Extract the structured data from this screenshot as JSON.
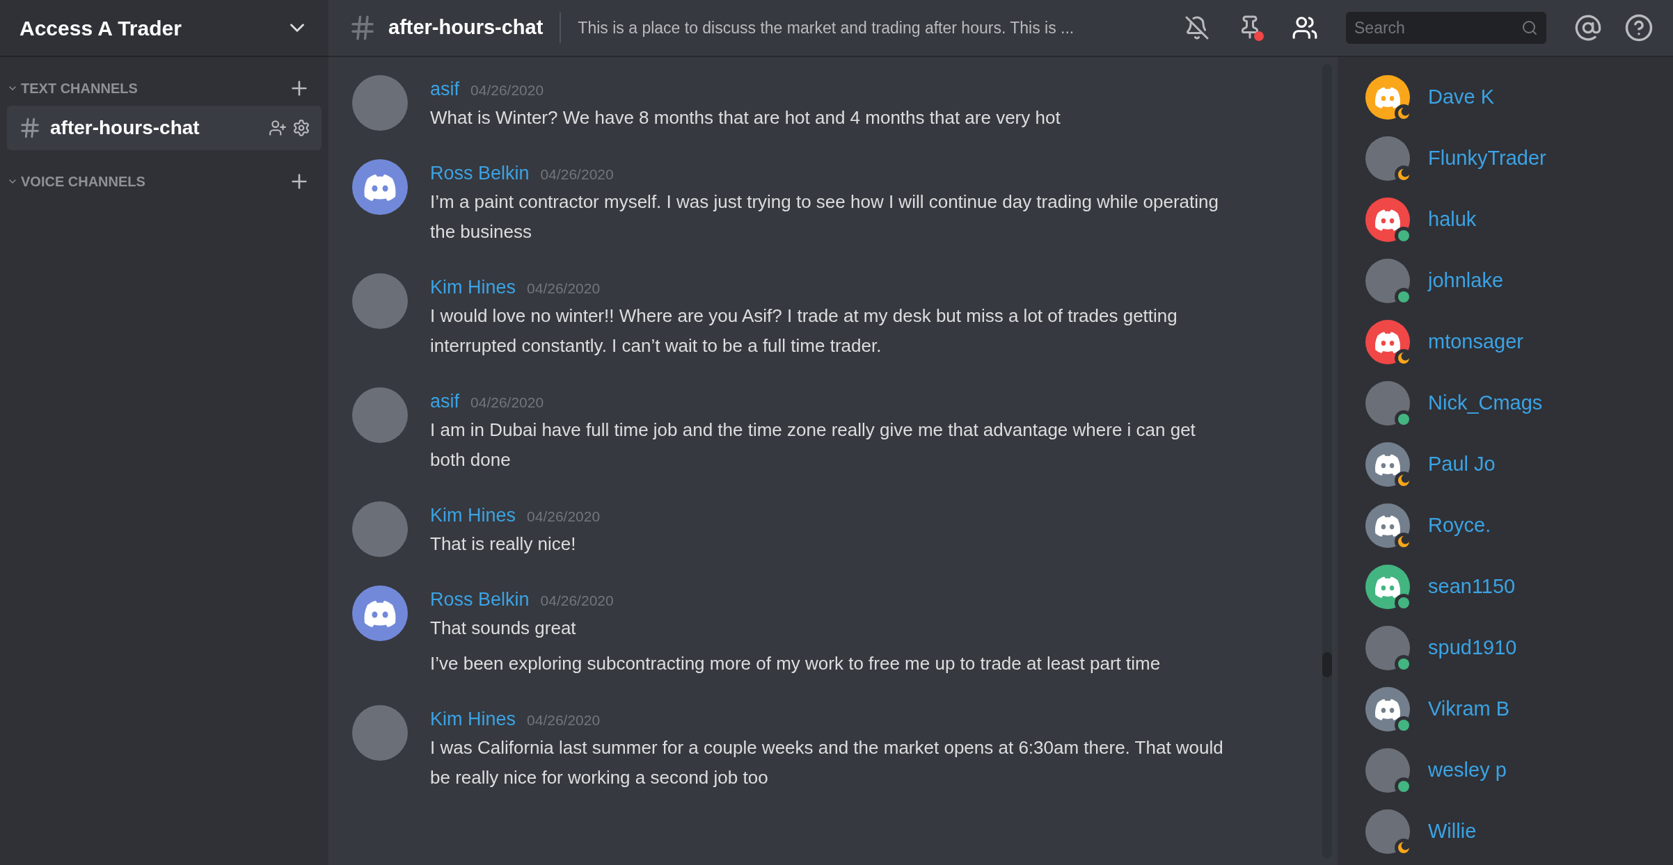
{
  "server": {
    "name": "Access A Trader"
  },
  "sidebar": {
    "categories": [
      {
        "label": "TEXT CHANNELS",
        "expanded": true,
        "channels": [
          {
            "name": "after-hours-chat",
            "selected": true
          }
        ]
      },
      {
        "label": "VOICE CHANNELS",
        "expanded": true
      }
    ]
  },
  "channel": {
    "name": "after-hours-chat",
    "topic": "This is a place to discuss the market and trading after hours. This is ..."
  },
  "search": {
    "placeholder": "Search"
  },
  "messages": [
    {
      "author": "asif",
      "date": "04/26/2020",
      "avatar": {
        "kind": "photo"
      },
      "texts": [
        "What is Winter? We have 8 months that are hot and 4 months that are very hot"
      ]
    },
    {
      "author": "Ross Belkin",
      "date": "04/26/2020",
      "avatar": {
        "kind": "logo",
        "color": "#7289da"
      },
      "texts": [
        "I’m a paint contractor myself. I was just trying to see how I will continue day trading while operating the business"
      ]
    },
    {
      "author": "Kim Hines",
      "date": "04/26/2020",
      "avatar": {
        "kind": "photo"
      },
      "texts": [
        "I would love no winter!! Where are you Asif? I trade at my desk but miss a lot of trades getting interrupted constantly. I can’t wait to be a full time trader."
      ]
    },
    {
      "author": "asif",
      "date": "04/26/2020",
      "avatar": {
        "kind": "photo"
      },
      "texts": [
        "I am in Dubai have full time job and the time zone really give me that advantage where i can get both done"
      ]
    },
    {
      "author": "Kim Hines",
      "date": "04/26/2020",
      "avatar": {
        "kind": "photo"
      },
      "texts": [
        "That is really nice!"
      ]
    },
    {
      "author": "Ross Belkin",
      "date": "04/26/2020",
      "avatar": {
        "kind": "logo",
        "color": "#7289da"
      },
      "texts": [
        "That sounds great",
        "I’ve been exploring subcontracting more of my work to free me up to trade at least part time"
      ]
    },
    {
      "author": "Kim Hines",
      "date": "04/26/2020",
      "avatar": {
        "kind": "photo"
      },
      "texts": [
        "I was California last summer for a couple weeks and the market opens at 6:30am there. That would be really nice for working a second job too"
      ]
    }
  ],
  "members": [
    {
      "name": "Dave K",
      "avatar": {
        "kind": "logo",
        "color": "#faa61a"
      },
      "idle": true
    },
    {
      "name": "FlunkyTrader",
      "avatar": {
        "kind": "photo"
      },
      "idle": true
    },
    {
      "name": "haluk",
      "avatar": {
        "kind": "logo",
        "color": "#f04747"
      },
      "idle": false
    },
    {
      "name": "johnlake",
      "avatar": {
        "kind": "photo"
      },
      "idle": false
    },
    {
      "name": "mtonsager",
      "avatar": {
        "kind": "logo",
        "color": "#f04747"
      },
      "idle": true
    },
    {
      "name": "Nick_Cmags",
      "avatar": {
        "kind": "photo"
      },
      "idle": false
    },
    {
      "name": "Paul Jo",
      "avatar": {
        "kind": "logo",
        "color": "#747f8d"
      },
      "idle": true
    },
    {
      "name": "Royce.",
      "avatar": {
        "kind": "logo",
        "color": "#747f8d"
      },
      "idle": true
    },
    {
      "name": "sean1150",
      "avatar": {
        "kind": "logo",
        "color": "#43b581"
      },
      "idle": false
    },
    {
      "name": "spud1910",
      "avatar": {
        "kind": "photo"
      },
      "idle": false
    },
    {
      "name": "Vikram B",
      "avatar": {
        "kind": "logo",
        "color": "#747f8d"
      },
      "idle": false
    },
    {
      "name": "wesley p",
      "avatar": {
        "kind": "photo"
      },
      "idle": false
    },
    {
      "name": "Willie",
      "avatar": {
        "kind": "photo"
      },
      "idle": true
    }
  ]
}
